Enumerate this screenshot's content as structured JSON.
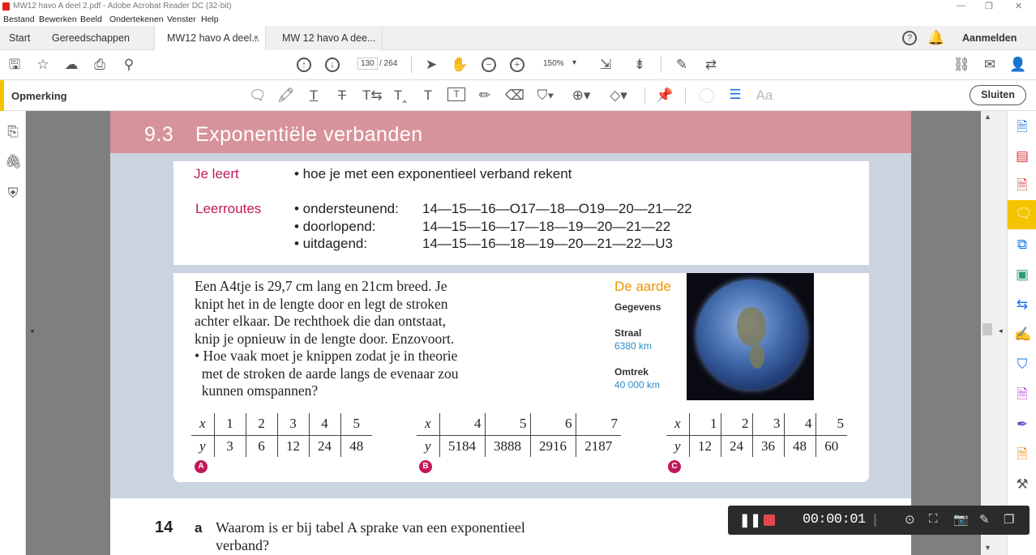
{
  "window": {
    "title": "MW12 havo A deel 2.pdf - Adobe Acrobat Reader DC (32-bit)"
  },
  "menu": [
    "Bestand",
    "Bewerken",
    "Beeld",
    "Ondertekenen",
    "Venster",
    "Help"
  ],
  "tabs": {
    "start": "Start",
    "tools": "Gereedschappen",
    "doc1": "MW12 havo A deel...",
    "doc2": "MW 12 havo A dee...",
    "close": "×",
    "signin": "Aanmelden"
  },
  "nav": {
    "page": "130",
    "total": "/ 264",
    "zoom": "150%"
  },
  "comment": {
    "label": "Opmerking",
    "close": "Sluiten"
  },
  "doc": {
    "section": "9.3",
    "title": "Exponentiële verbanden",
    "je_leert": "Je leert",
    "je_leert_text": "• hoe je met een exponentieel verband rekent",
    "leerroutes": "Leerroutes",
    "routes": [
      {
        "name": "• ondersteunend:",
        "seq": "14—15—16—O17—18—O19—20—21—22"
      },
      {
        "name": "• doorlopend:",
        "seq": "14—15—16—17—18—19—20—21—22"
      },
      {
        "name": "• uitdagend:",
        "seq": "14—15—16—18—19—20—21—22—U3"
      }
    ],
    "intro": [
      "Een A4tje is 29,7 cm lang en 21cm breed. Je",
      "knipt het in de lengte door en legt de stroken",
      "achter elkaar. De rechthoek die dan ontstaat,",
      "knip je opnieuw in de lengte door. Enzovoort.",
      "• Hoe vaak moet je knippen zodat je in theorie",
      "  met de stroken de aarde langs de evenaar zou",
      "  kunnen omspannen?"
    ],
    "aarde": {
      "title": "De aarde",
      "gegevens": "Gegevens",
      "straal": "Straal",
      "straal_val": "6380 km",
      "omtrek": "Omtrek",
      "omtrek_val": "40 000 km"
    },
    "tableA": {
      "x": [
        "x",
        "1",
        "2",
        "3",
        "4",
        "5"
      ],
      "y": [
        "y",
        "3",
        "6",
        "12",
        "24",
        "48"
      ],
      "label": "A"
    },
    "tableB": {
      "x": [
        "x",
        "4",
        "5",
        "6",
        "7"
      ],
      "y": [
        "y",
        "5184",
        "3888",
        "2916",
        "2187"
      ],
      "label": "B"
    },
    "tableC": {
      "x": [
        "x",
        "1",
        "2",
        "3",
        "4",
        "5"
      ],
      "y": [
        "y",
        "12",
        "24",
        "36",
        "48",
        "60"
      ],
      "label": "C"
    },
    "q_num": "14",
    "q_letter": "a",
    "q_text1": "Waarom is er bij tabel A sprake van een exponentieel",
    "q_text2": "verband?"
  },
  "recorder": {
    "time": "00:00:01"
  }
}
